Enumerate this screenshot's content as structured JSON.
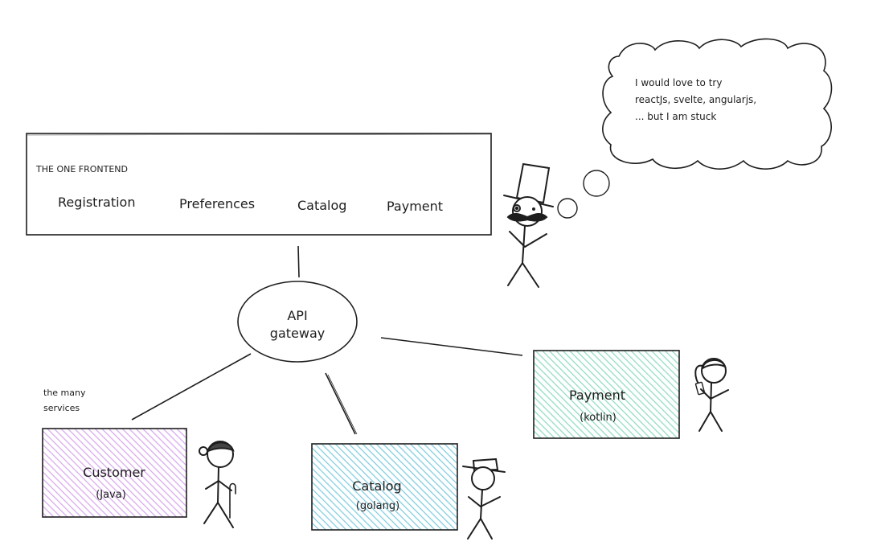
{
  "frontend": {
    "title": "THE ONE FRONTEND",
    "modules": [
      "Registration",
      "Preferences",
      "Catalog",
      "Payment"
    ]
  },
  "thought_bubble": {
    "lines": [
      "I would love to try",
      "reactJs, svelte, angularjs,",
      "... but I am stuck"
    ]
  },
  "gateway": {
    "line1": "API",
    "line2": "gateway"
  },
  "services_label": {
    "line1": "the many",
    "line2": "services"
  },
  "services": [
    {
      "name": "Customer",
      "lang": "(Java)",
      "color": "#d9a8ef"
    },
    {
      "name": "Catalog",
      "lang": "(golang)",
      "color": "#7fcde0"
    },
    {
      "name": "Payment",
      "lang": "(kotlin)",
      "color": "#8fdcc4"
    }
  ],
  "colors": {
    "stroke": "#1e1e1e"
  }
}
